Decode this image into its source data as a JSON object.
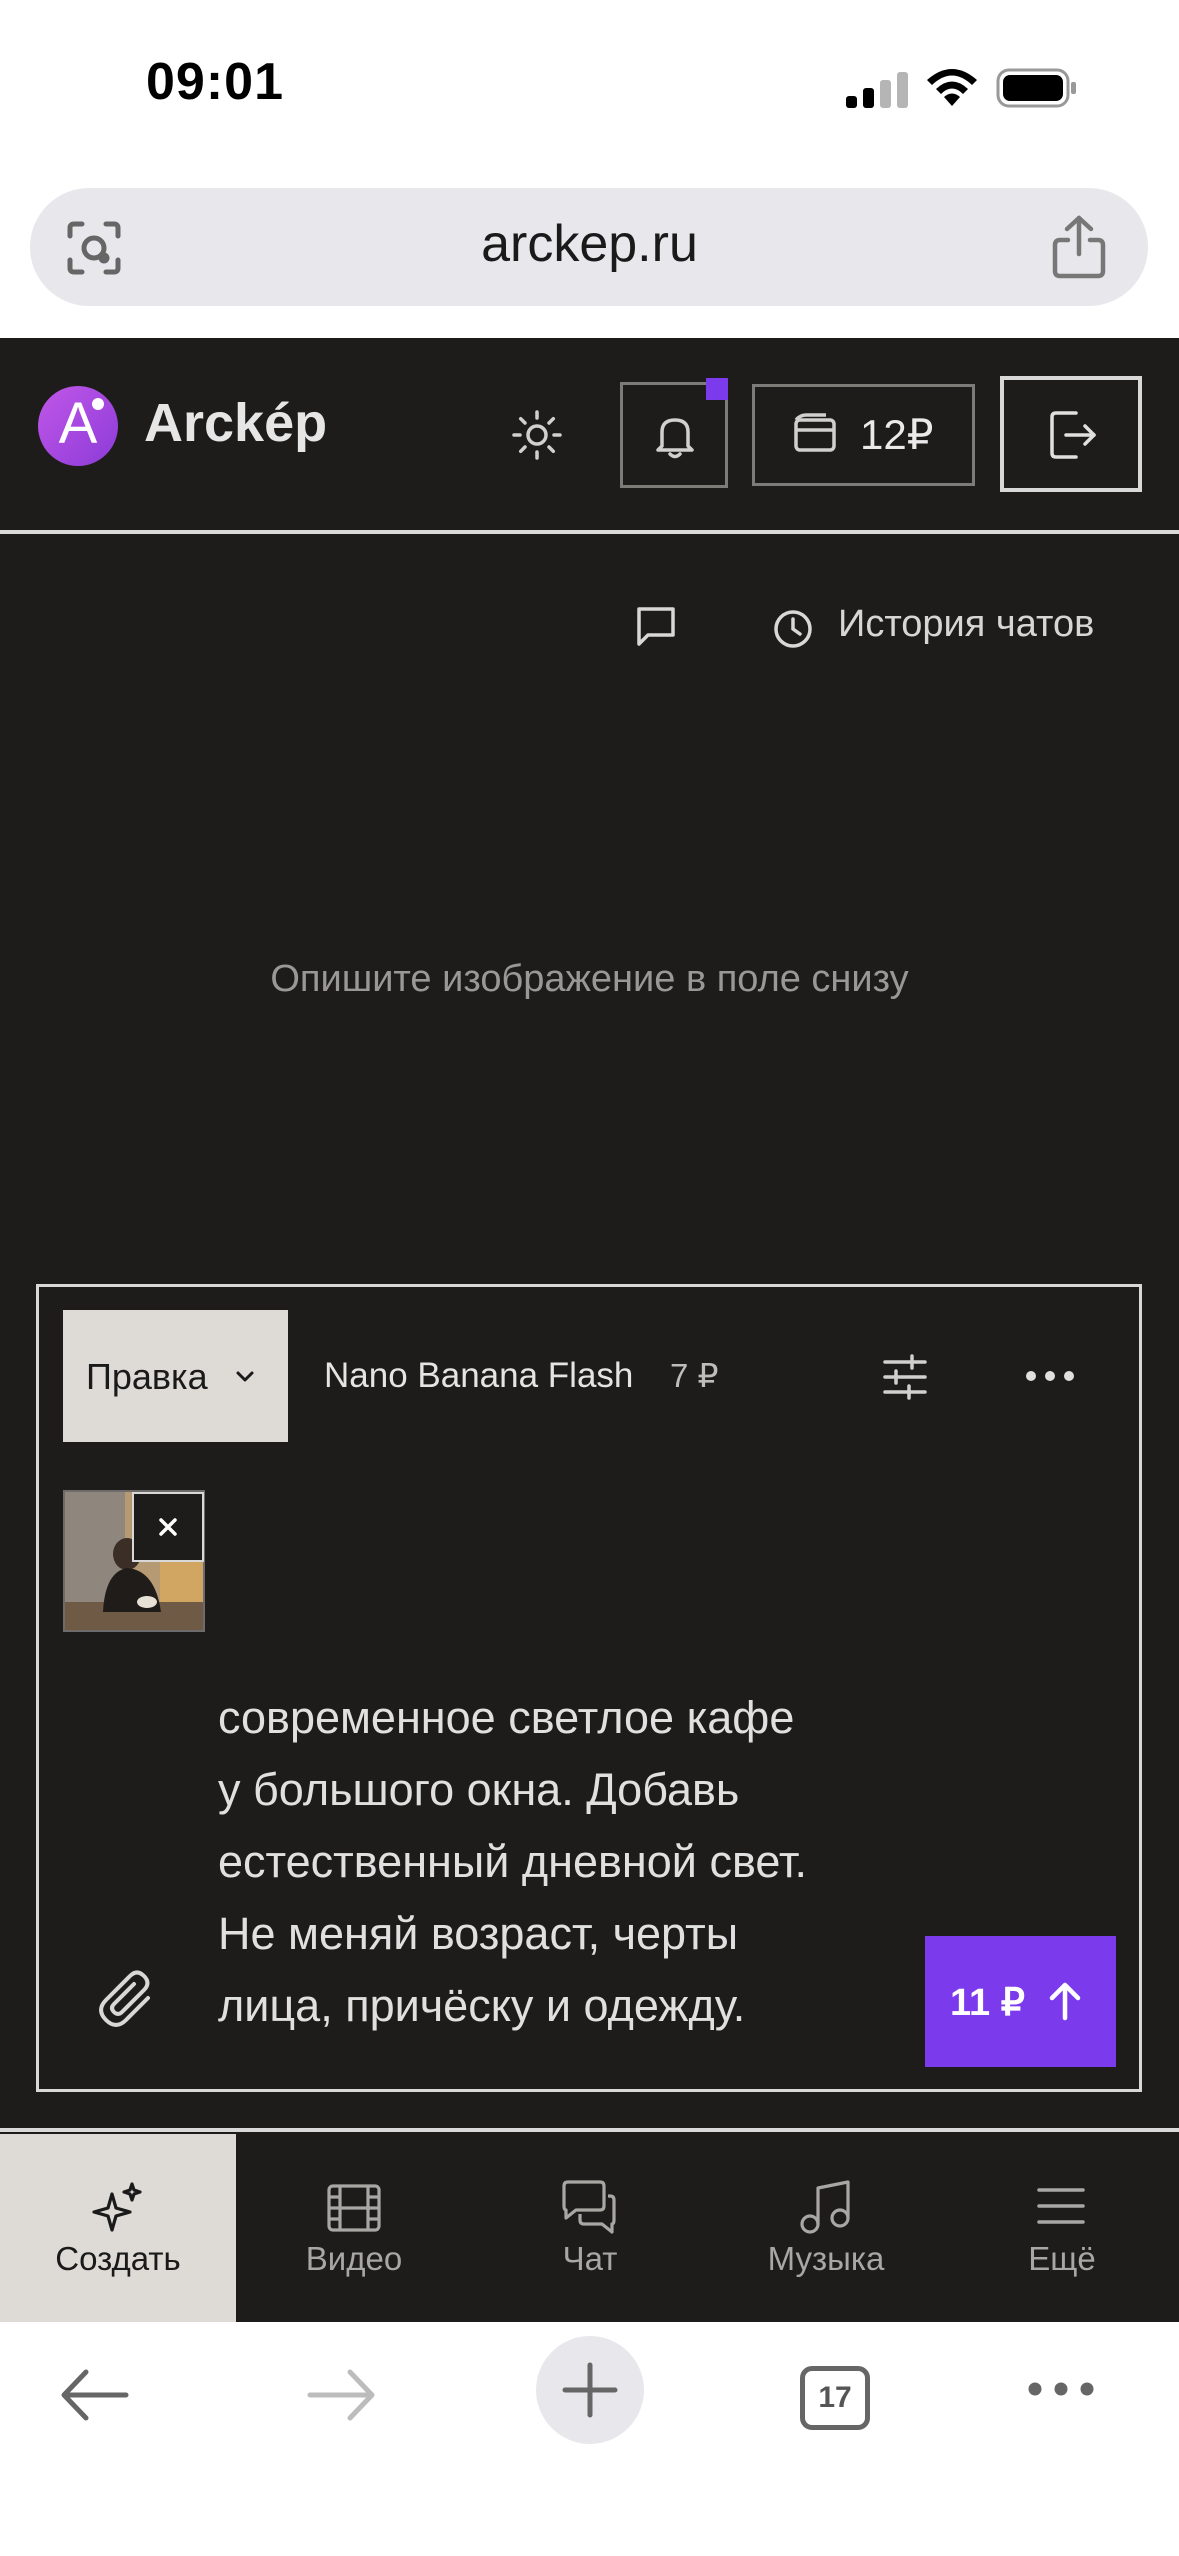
{
  "status_bar": {
    "time": "09:01"
  },
  "browser": {
    "url": "arckep.ru",
    "tab_count": "17"
  },
  "header": {
    "brand": "Arckép",
    "logo_letter": "A",
    "balance": "12₽"
  },
  "chat": {
    "history_label": "История чатов",
    "empty_hint": "Опишите изображение в поле снизу"
  },
  "composer": {
    "mode_label": "Правка",
    "model_name": "Nano Banana Flash",
    "model_price": "7 ₽",
    "prompt_lines": [
      "современное светлое кафе",
      "у большого окна. Добавь",
      "естественный дневной свет.",
      "Не меняй возраст, черты",
      "лица, причёску и одежду."
    ],
    "send_price": "11 ₽"
  },
  "nav": {
    "items": [
      {
        "label": "Создать"
      },
      {
        "label": "Видео"
      },
      {
        "label": "Чат"
      },
      {
        "label": "Музыка"
      },
      {
        "label": "Ещё"
      }
    ]
  },
  "colors": {
    "accent": "#7c3aed",
    "app_bg": "#1e1c1b",
    "active_bg": "#dedbd6"
  }
}
